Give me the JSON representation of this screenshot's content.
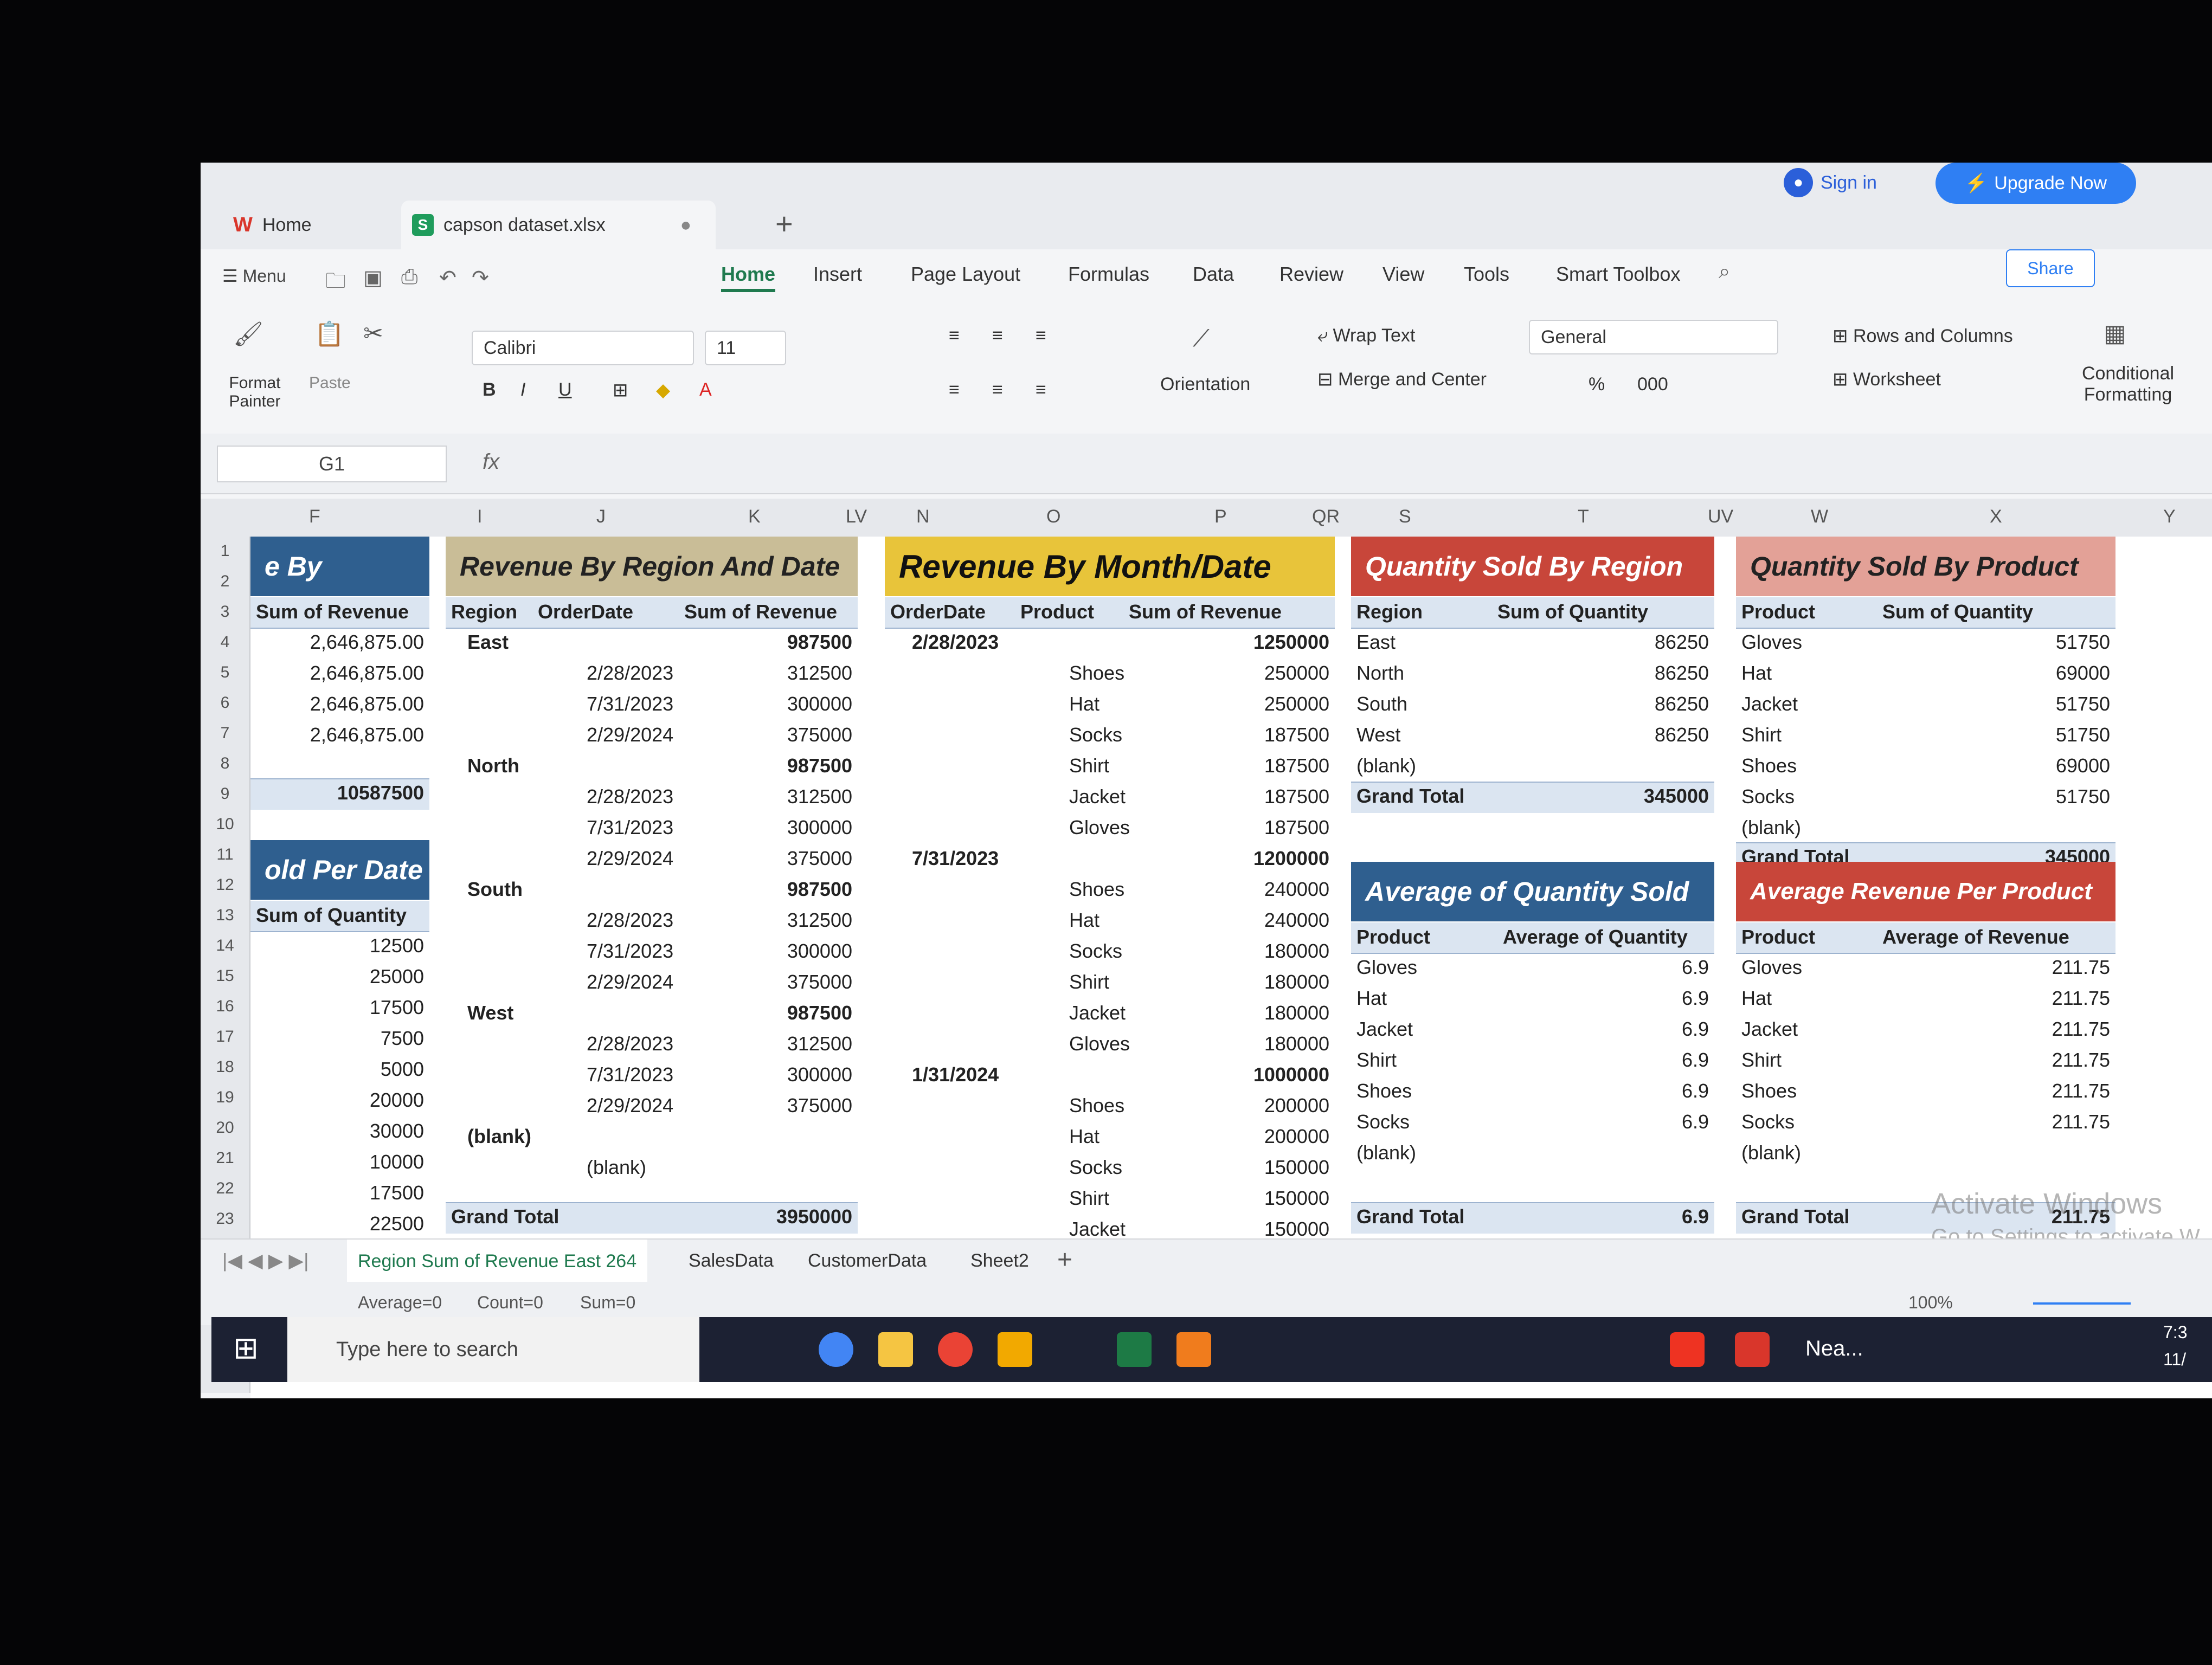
{
  "tabs": {
    "home": "Home",
    "file": "capson dataset.xlsx"
  },
  "account": {
    "sign_in": "Sign in",
    "upgrade": "Upgrade Now",
    "share": "Share"
  },
  "menu": {
    "menu_label": "Menu",
    "items": [
      "Home",
      "Insert",
      "Page Layout",
      "Formulas",
      "Data",
      "Review",
      "View",
      "Tools",
      "Smart Toolbox"
    ]
  },
  "ribbon": {
    "format_painter": "Format Painter",
    "paste": "Paste",
    "font": "Calibri",
    "font_size": "11",
    "wrap_text": "Wrap Text",
    "orientation": "Orientation",
    "merge_center": "Merge and Center",
    "number_format": "General",
    "rows_columns": "Rows and Columns",
    "worksheet": "Worksheet",
    "conditional_formatting": "Conditional Formatting"
  },
  "formula_bar": {
    "name_box": "G1",
    "fx": "fx"
  },
  "columns": [
    "F",
    "I",
    "J",
    "K",
    "LV",
    "N",
    "O",
    "P",
    "QR",
    "S",
    "T",
    "UV",
    "W",
    "X",
    "Y"
  ],
  "rows": [
    "1",
    "2",
    "3",
    "4",
    "5",
    "6",
    "7",
    "8",
    "9",
    "10",
    "11",
    "12",
    "13",
    "14",
    "15",
    "16",
    "17",
    "18",
    "19",
    "20",
    "21",
    "22",
    "23"
  ],
  "panel_f": {
    "title1": "e By",
    "header1": "Sum of Revenue",
    "values1": [
      "2,646,875.00",
      "2,646,875.00",
      "2,646,875.00",
      "2,646,875.00"
    ],
    "total1": "10587500",
    "title2": "old Per Date",
    "header2": "Sum of Quantity",
    "values2": [
      "12500",
      "25000",
      "17500",
      "7500",
      "5000",
      "20000",
      "30000",
      "10000",
      "17500",
      "22500"
    ]
  },
  "region_date": {
    "title": "Revenue By Region And Date",
    "headers": [
      "Region",
      "OrderDate",
      "Sum of Revenue"
    ],
    "rows": [
      [
        "East",
        "",
        "987500"
      ],
      [
        "",
        "2/28/2023",
        "312500"
      ],
      [
        "",
        "7/31/2023",
        "300000"
      ],
      [
        "",
        "2/29/2024",
        "375000"
      ],
      [
        "North",
        "",
        "987500"
      ],
      [
        "",
        "2/28/2023",
        "312500"
      ],
      [
        "",
        "7/31/2023",
        "300000"
      ],
      [
        "",
        "2/29/2024",
        "375000"
      ],
      [
        "South",
        "",
        "987500"
      ],
      [
        "",
        "2/28/2023",
        "312500"
      ],
      [
        "",
        "7/31/2023",
        "300000"
      ],
      [
        "",
        "2/29/2024",
        "375000"
      ],
      [
        "West",
        "",
        "987500"
      ],
      [
        "",
        "2/28/2023",
        "312500"
      ],
      [
        "",
        "7/31/2023",
        "300000"
      ],
      [
        "",
        "2/29/2024",
        "375000"
      ],
      [
        "(blank)",
        "",
        ""
      ],
      [
        "",
        "(blank)",
        ""
      ]
    ],
    "grand_total_label": "Grand Total",
    "grand_total": "3950000"
  },
  "month_date": {
    "title": "Revenue By Month/Date",
    "headers": [
      "OrderDate",
      "Product",
      "Sum of Revenue"
    ],
    "rows": [
      [
        "2/28/2023",
        "",
        "1250000"
      ],
      [
        "",
        "Shoes",
        "250000"
      ],
      [
        "",
        "Hat",
        "250000"
      ],
      [
        "",
        "Socks",
        "187500"
      ],
      [
        "",
        "Shirt",
        "187500"
      ],
      [
        "",
        "Jacket",
        "187500"
      ],
      [
        "",
        "Gloves",
        "187500"
      ],
      [
        "7/31/2023",
        "",
        "1200000"
      ],
      [
        "",
        "Shoes",
        "240000"
      ],
      [
        "",
        "Hat",
        "240000"
      ],
      [
        "",
        "Socks",
        "180000"
      ],
      [
        "",
        "Shirt",
        "180000"
      ],
      [
        "",
        "Jacket",
        "180000"
      ],
      [
        "",
        "Gloves",
        "180000"
      ],
      [
        "1/31/2024",
        "",
        "1000000"
      ],
      [
        "",
        "Shoes",
        "200000"
      ],
      [
        "",
        "Hat",
        "200000"
      ],
      [
        "",
        "Socks",
        "150000"
      ],
      [
        "",
        "Shirt",
        "150000"
      ],
      [
        "",
        "Jacket",
        "150000"
      ]
    ]
  },
  "qty_region": {
    "title": "Quantity Sold By Region",
    "headers": [
      "Region",
      "Sum of Quantity"
    ],
    "rows": [
      [
        "East",
        "86250"
      ],
      [
        "North",
        "86250"
      ],
      [
        "South",
        "86250"
      ],
      [
        "West",
        "86250"
      ],
      [
        "(blank)",
        ""
      ]
    ],
    "grand_total_label": "Grand Total",
    "grand_total": "345000"
  },
  "avg_qty": {
    "title": "Average of Quantity Sold",
    "headers": [
      "Product",
      "Average of Quantity"
    ],
    "rows": [
      [
        "Gloves",
        "6.9"
      ],
      [
        "Hat",
        "6.9"
      ],
      [
        "Jacket",
        "6.9"
      ],
      [
        "Shirt",
        "6.9"
      ],
      [
        "Shoes",
        "6.9"
      ],
      [
        "Socks",
        "6.9"
      ],
      [
        "(blank)",
        ""
      ]
    ],
    "grand_total_label": "Grand Total",
    "grand_total": "6.9"
  },
  "qty_product": {
    "title": "Quantity Sold By Product",
    "headers": [
      "Product",
      "Sum of Quantity"
    ],
    "rows": [
      [
        "Gloves",
        "51750"
      ],
      [
        "Hat",
        "69000"
      ],
      [
        "Jacket",
        "51750"
      ],
      [
        "Shirt",
        "51750"
      ],
      [
        "Shoes",
        "69000"
      ],
      [
        "Socks",
        "51750"
      ],
      [
        "(blank)",
        ""
      ]
    ],
    "grand_total_label": "Grand Total",
    "grand_total": "345000"
  },
  "avg_revenue": {
    "title": "Average Revenue Per Product",
    "headers": [
      "Product",
      "Average of Revenue"
    ],
    "rows": [
      [
        "Gloves",
        "211.75"
      ],
      [
        "Hat",
        "211.75"
      ],
      [
        "Jacket",
        "211.75"
      ],
      [
        "Shirt",
        "211.75"
      ],
      [
        "Shoes",
        "211.75"
      ],
      [
        "Socks",
        "211.75"
      ],
      [
        "(blank)",
        ""
      ]
    ],
    "grand_total_label": "Grand Total",
    "grand_total": "211.75"
  },
  "sheet_tabs": [
    "Region Sum of Revenue East 264",
    "SalesData",
    "CustomerData",
    "Sheet2"
  ],
  "status": {
    "average": "Average=0",
    "count": "Count=0",
    "sum": "Sum=0",
    "zoom": "100%"
  },
  "watermark": {
    "line1": "Activate Windows",
    "line2": "Go to Settings to activate W"
  },
  "taskbar": {
    "search_placeholder": "Type here to search",
    "news": "Nea...",
    "time": "7:3",
    "date": "11/"
  },
  "colors": {
    "accent_green": "#1f7a4f",
    "upgrade_blue": "#2f7ff3",
    "pivot_blue": "#2f5f8f",
    "pivot_red": "#c8463a",
    "pivot_yellow": "#e8c43a"
  }
}
